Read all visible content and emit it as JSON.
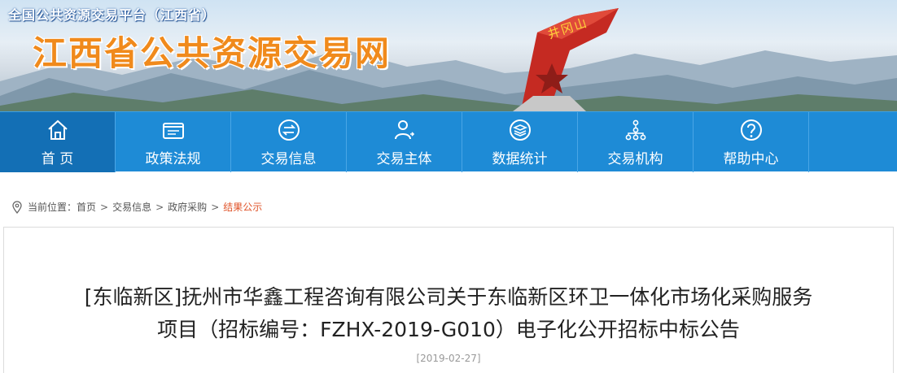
{
  "header": {
    "small_title": "全国公共资源交易平台（江西省）",
    "big_title": "江西省公共资源交易网",
    "monument_text": "井冈山"
  },
  "nav": {
    "items": [
      {
        "label": "首 页",
        "icon": "home-icon",
        "active": true
      },
      {
        "label": "政策法规",
        "icon": "folder-icon"
      },
      {
        "label": "交易信息",
        "icon": "exchange-icon"
      },
      {
        "label": "交易主体",
        "icon": "user-icon"
      },
      {
        "label": "数据统计",
        "icon": "layers-icon"
      },
      {
        "label": "交易机构",
        "icon": "org-chart-icon"
      },
      {
        "label": "帮助中心",
        "icon": "help-icon"
      }
    ]
  },
  "breadcrumb": {
    "prefix": "当前位置：",
    "items": [
      "首页",
      "交易信息",
      "政府采购",
      "结果公示"
    ],
    "separator": ">"
  },
  "article": {
    "title_line1": "[东临新区]抚州市华鑫工程咨询有限公司关于东临新区环卫一体化市场化采购服务",
    "title_line2": "项目（招标编号：FZHX-2019-G010）电子化公开招标中标公告",
    "date": "[2019-02-27]"
  },
  "colors": {
    "nav_bg": "#1e8bd6",
    "nav_active": "#136fb5",
    "title_orange": "#f08a1c",
    "crumb_current": "#e0542a"
  }
}
